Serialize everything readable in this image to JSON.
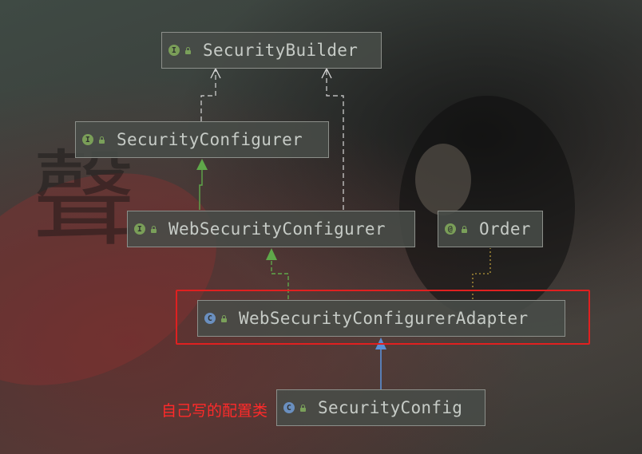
{
  "diagram": {
    "nodes": [
      {
        "id": "security_builder",
        "label": "SecurityBuilder",
        "kind": "interface"
      },
      {
        "id": "security_configurer",
        "label": "SecurityConfigurer",
        "kind": "interface"
      },
      {
        "id": "web_security_configurer",
        "label": "WebSecurityConfigurer",
        "kind": "interface"
      },
      {
        "id": "order",
        "label": "Order",
        "kind": "annotation"
      },
      {
        "id": "web_security_configurer_adapter",
        "label": "WebSecurityConfigurerAdapter",
        "kind": "class"
      },
      {
        "id": "security_config",
        "label": "SecurityConfig",
        "kind": "class"
      }
    ],
    "edges": [
      {
        "from": "security_configurer",
        "to": "security_builder",
        "type": "uses-dashed"
      },
      {
        "from": "web_security_configurer",
        "to": "security_builder",
        "type": "uses-dashed"
      },
      {
        "from": "web_security_configurer",
        "to": "security_configurer",
        "type": "extends"
      },
      {
        "from": "web_security_configurer_adapter",
        "to": "web_security_configurer",
        "type": "implements"
      },
      {
        "from": "web_security_configurer_adapter",
        "to": "order",
        "type": "annotated-dotted"
      },
      {
        "from": "security_config",
        "to": "web_security_configurer_adapter",
        "type": "extends-class"
      }
    ],
    "annotation_text": "自己写的配置类",
    "colors": {
      "highlight": "#e02020",
      "annotation_text": "#ff2a2a",
      "interface_arrow": "#5fa84a",
      "class_arrow": "#5b8fd6",
      "dashed": "#d8d8d8",
      "dotted": "#b89a3a"
    }
  }
}
